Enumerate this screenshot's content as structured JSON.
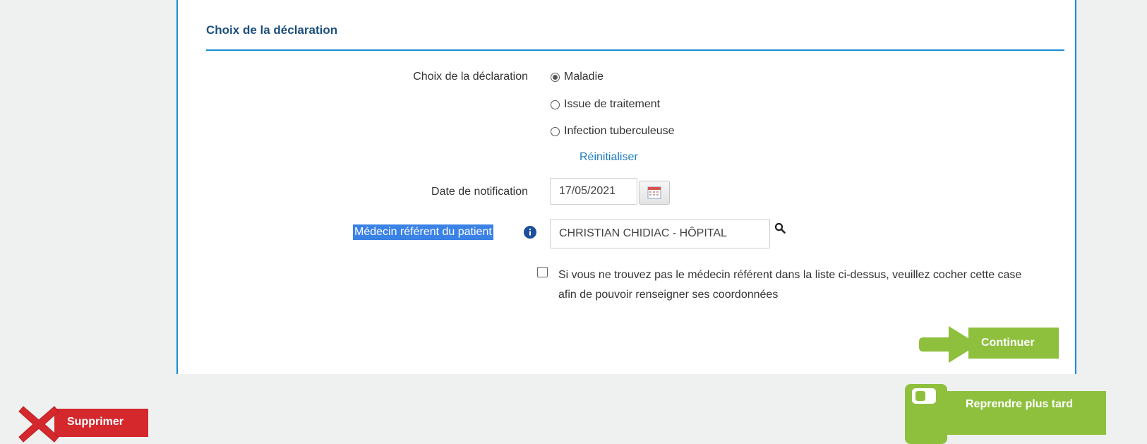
{
  "section": {
    "title": "Choix de la déclaration"
  },
  "declaration": {
    "label": "Choix de la déclaration",
    "options": [
      "Maladie",
      "Issue de traitement",
      "Infection tuberculeuse"
    ],
    "selected": "Maladie",
    "reset_link": "Réinitialiser"
  },
  "notification_date": {
    "label": "Date de notification",
    "value": "17/05/2021"
  },
  "referring_doctor": {
    "label": "Médecin référent du patient",
    "value": "CHRISTIAN CHIDIAC - HÔPITAL"
  },
  "not_found_checkbox": {
    "text": "Si vous ne trouvez pas le médecin référent dans la liste ci-dessus, veuillez cocher cette case afin de pouvoir renseigner ses coordonnées",
    "checked": false
  },
  "buttons": {
    "continue": "Continuer",
    "delete": "Supprimer",
    "resume_later": "Reprendre plus tard"
  },
  "colors": {
    "accent_blue": "#1a8fd1",
    "title_blue": "#1c4f7d",
    "green": "#8ec03e",
    "red": "#d4282d"
  }
}
